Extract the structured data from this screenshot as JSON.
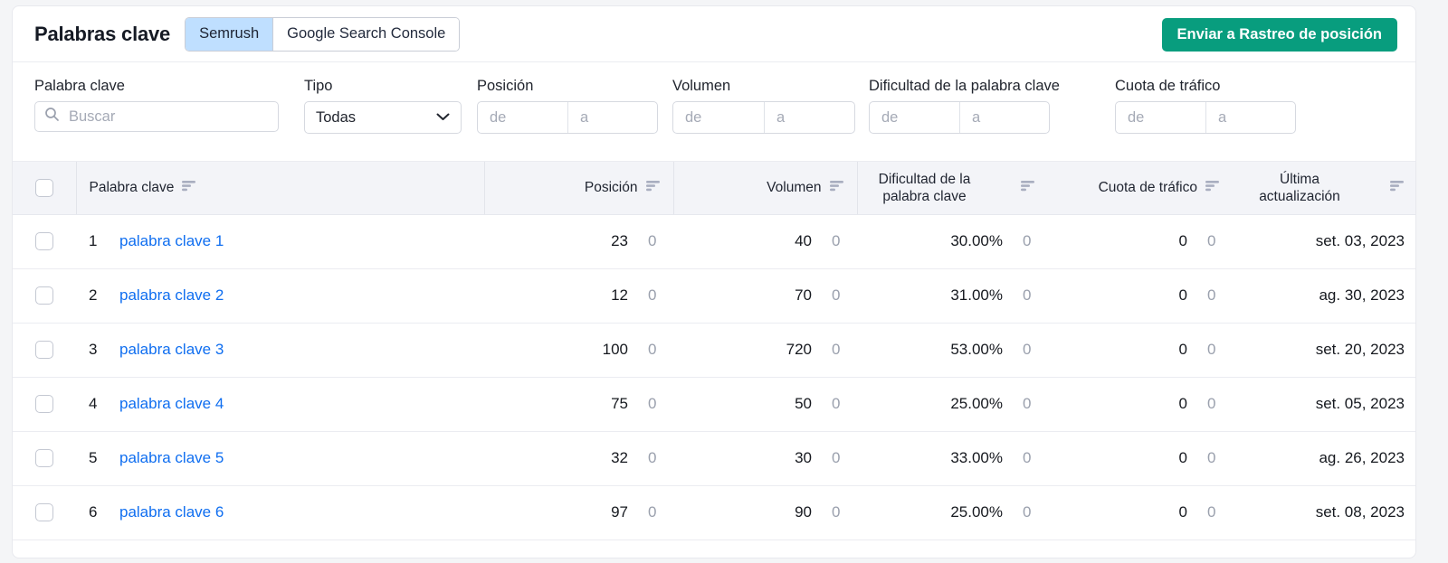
{
  "header": {
    "title": "Palabras clave",
    "tabs": [
      {
        "label": "Semrush",
        "active": true
      },
      {
        "label": "Google Search Console",
        "active": false
      }
    ],
    "cta_label": "Enviar a Rastreo de posición",
    "cta_color": "#089d7e",
    "active_tab_color": "#bfdfff"
  },
  "filters": [
    {
      "label": "Palabra clave",
      "type": "search",
      "icon": "search-icon",
      "value": "",
      "placeholder": "Buscar"
    },
    {
      "label": "Tipo",
      "type": "select",
      "value": "Todas",
      "icon": "chevron-down-icon"
    },
    {
      "label": "Posición",
      "type": "range",
      "from_value": "",
      "from_placeholder": "de",
      "to_value": "",
      "to_placeholder": "a"
    },
    {
      "label": "Volumen",
      "type": "range",
      "from_value": "",
      "from_placeholder": "de",
      "to_value": "",
      "to_placeholder": "a"
    },
    {
      "label": "Dificultad de la palabra clave",
      "type": "range",
      "from_value": "",
      "from_placeholder": "de",
      "to_value": "",
      "to_placeholder": "a"
    },
    {
      "label": "Cuota de tráfico",
      "type": "range",
      "from_value": "",
      "from_placeholder": "de",
      "to_value": "",
      "to_placeholder": "a"
    }
  ],
  "table": {
    "select_all_checked": false,
    "columns": [
      {
        "key": "checkbox",
        "label": "",
        "sortable": false
      },
      {
        "key": "keyword",
        "label": "Palabra clave",
        "sortable": true
      },
      {
        "key": "position",
        "label": "Posición",
        "sortable": true
      },
      {
        "key": "volume",
        "label": "Volumen",
        "sortable": true
      },
      {
        "key": "kd",
        "label": "Dificultad de la palabra clave",
        "sortable": true
      },
      {
        "key": "share",
        "label": "Cuota de tráfico",
        "sortable": true,
        "highlighted": true
      },
      {
        "key": "updated",
        "label": "Última actualización",
        "sortable": true
      }
    ],
    "rows": [
      {
        "index": "1",
        "keyword": "palabra clave 1",
        "position": "23",
        "position_sub": "0",
        "volume": "40",
        "volume_sub": "0",
        "kd": "30.00%",
        "kd_sub": "0",
        "share": "0",
        "share_sub": "0",
        "updated": "set. 03, 2023"
      },
      {
        "index": "2",
        "keyword": "palabra clave 2",
        "position": "12",
        "position_sub": "0",
        "volume": "70",
        "volume_sub": "0",
        "kd": "31.00%",
        "kd_sub": "0",
        "share": "0",
        "share_sub": "0",
        "updated": "ag. 30, 2023"
      },
      {
        "index": "3",
        "keyword": "palabra clave 3",
        "position": "100",
        "position_sub": "0",
        "volume": "720",
        "volume_sub": "0",
        "kd": "53.00%",
        "kd_sub": "0",
        "share": "0",
        "share_sub": "0",
        "updated": "set. 20, 2023"
      },
      {
        "index": "4",
        "keyword": "palabra clave 4",
        "position": "75",
        "position_sub": "0",
        "volume": "50",
        "volume_sub": "0",
        "kd": "25.00%",
        "kd_sub": "0",
        "share": "0",
        "share_sub": "0",
        "updated": "set. 05, 2023"
      },
      {
        "index": "5",
        "keyword": "palabra clave 5",
        "position": "32",
        "position_sub": "0",
        "volume": "30",
        "volume_sub": "0",
        "kd": "33.00%",
        "kd_sub": "0",
        "share": "0",
        "share_sub": "0",
        "updated": "ag. 26, 2023"
      },
      {
        "index": "6",
        "keyword": "palabra clave 6",
        "position": "97",
        "position_sub": "0",
        "volume": "90",
        "volume_sub": "0",
        "kd": "25.00%",
        "kd_sub": "0",
        "share": "0",
        "share_sub": "0",
        "updated": "set. 08, 2023"
      }
    ],
    "link_color": "#0f6ef0",
    "header_bg": "#f3f4f8",
    "highlight_bg": "#e4e6ef"
  }
}
